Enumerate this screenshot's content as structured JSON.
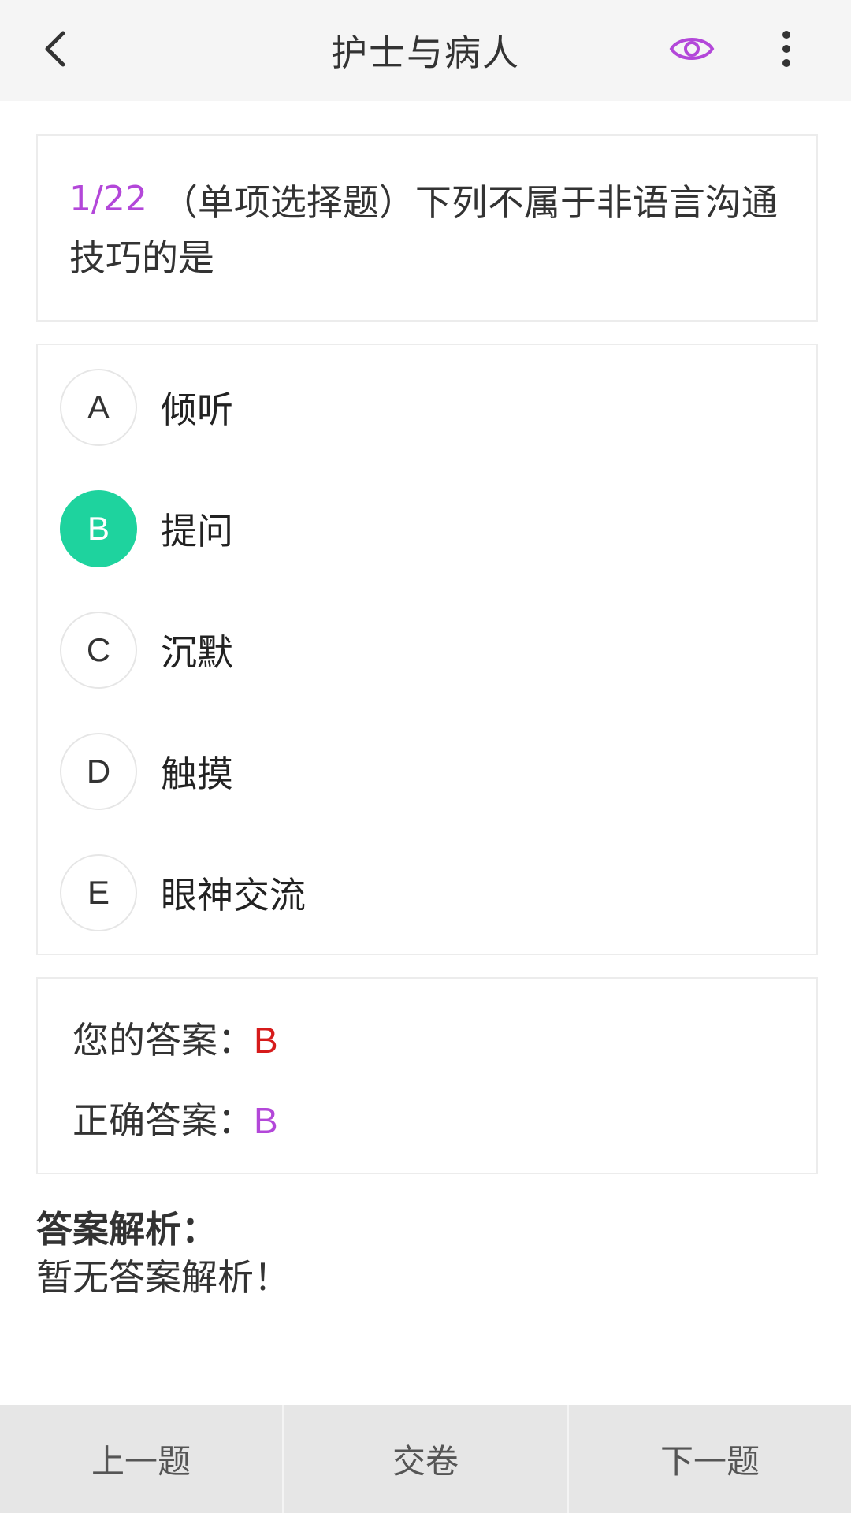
{
  "header": {
    "title": "护士与病人",
    "back_icon": "chevron-left-icon",
    "eye_icon": "eye-icon",
    "more_icon": "more-vertical-icon",
    "accent_color": "#b347d9"
  },
  "question": {
    "index": "1/22",
    "text": "（单项选择题）下列不属于非语言沟通技巧的是"
  },
  "options": [
    {
      "letter": "A",
      "text": "倾听",
      "selected": false
    },
    {
      "letter": "B",
      "text": "提问",
      "selected": true
    },
    {
      "letter": "C",
      "text": "沉默",
      "selected": false
    },
    {
      "letter": "D",
      "text": "触摸",
      "selected": false
    },
    {
      "letter": "E",
      "text": "眼神交流",
      "selected": false
    }
  ],
  "answer": {
    "your_label": "您的答案：",
    "your_value": "B",
    "correct_label": "正确答案：",
    "correct_value": "B",
    "your_color": "#d61b1b",
    "correct_color": "#b347d9",
    "selected_color": "#1ed39e"
  },
  "analysis": {
    "title": "答案解析：",
    "text": "暂无答案解析！"
  },
  "footer": {
    "prev_label": "上一题",
    "submit_label": "交卷",
    "next_label": "下一题"
  }
}
